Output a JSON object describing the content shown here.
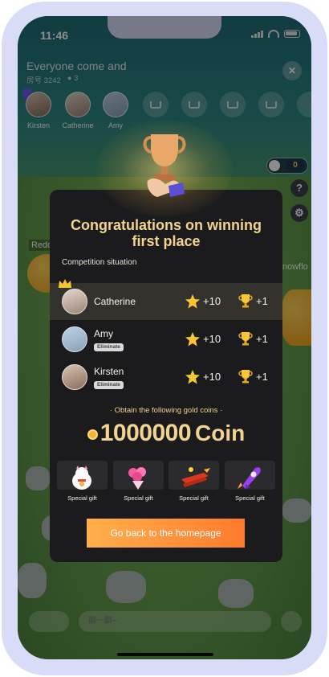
{
  "status_bar": {
    "time": "11:46"
  },
  "room": {
    "title": "Everyone come and",
    "room_id_label": "房号 3242",
    "member_count": "3",
    "close_icon": "close-icon"
  },
  "seats": [
    {
      "name": "Kirsten"
    },
    {
      "name": "Catherine"
    },
    {
      "name": "Amy"
    }
  ],
  "side_widgets": {
    "coin_value": "0",
    "help_icon": "question-icon",
    "settings_icon": "gear-icon"
  },
  "background_tags": {
    "left": "Redo",
    "right": "nowflo"
  },
  "modal": {
    "title_line1": "Congratulations on winning",
    "title_line2": "first place",
    "section_label": "Competition situation",
    "rankings": [
      {
        "name": "Catherine",
        "tag": "",
        "star_points": "+10",
        "trophy_points": "+1"
      },
      {
        "name": "Amy",
        "tag": "Eliminate",
        "star_points": "+10",
        "trophy_points": "+1"
      },
      {
        "name": "Kirsten",
        "tag": "Eliminate",
        "star_points": "+10",
        "trophy_points": "+1"
      }
    ],
    "reward_title": "· Obtain the following gold coins ·",
    "coin_amount": "1000000",
    "coin_unit": "Coin",
    "gifts": [
      {
        "label": "Special gift",
        "icon": "lucky-cat-icon"
      },
      {
        "label": "Special gift",
        "icon": "flower-bouquet-icon"
      },
      {
        "label": "Special gift",
        "icon": "rocket-sled-icon"
      },
      {
        "label": "Special gift",
        "icon": "purple-rocket-icon"
      }
    ],
    "home_button": "Go back to the homepage"
  },
  "chat": {
    "placeholder": "聊一聊~"
  },
  "colors": {
    "accent_gold": "#f2d38f",
    "button_start": "#ffb04c",
    "button_end": "#ff7a2c",
    "modal_bg": "#1b1b1d"
  }
}
